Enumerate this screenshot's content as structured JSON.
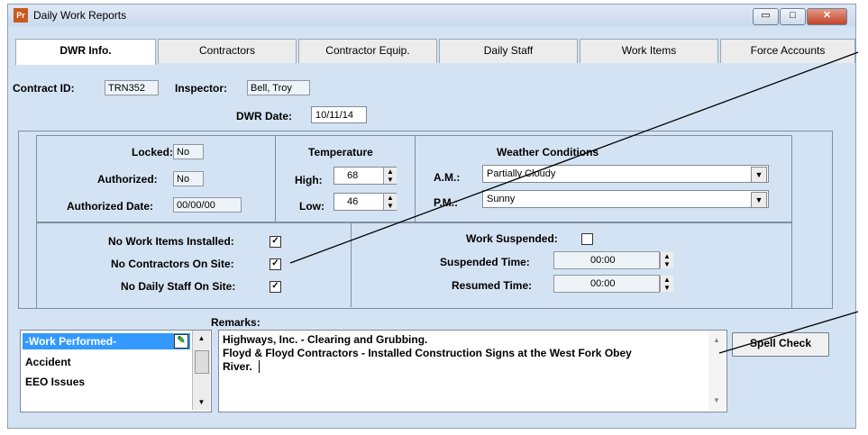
{
  "window": {
    "title": "Daily Work Reports",
    "icon_text": "Pr",
    "btn_min": "▭",
    "btn_max": "□",
    "btn_close": "✕"
  },
  "tabs": [
    "DWR Info.",
    "Contractors",
    "Contractor Equip.",
    "Daily Staff",
    "Work Items",
    "Force Accounts"
  ],
  "header": {
    "contract_id_label": "Contract ID:",
    "contract_id_value": "TRN352",
    "inspector_label": "Inspector:",
    "inspector_value": "Bell, Troy",
    "dwr_date_label": "DWR Date:",
    "dwr_date_value": "10/11/14"
  },
  "status": {
    "locked_label": "Locked:",
    "locked_value": "No",
    "authorized_label": "Authorized:",
    "authorized_value": "No",
    "authorized_date_label": "Authorized Date:",
    "authorized_date_value": "00/00/00"
  },
  "temperature": {
    "heading": "Temperature",
    "high_label": "High:",
    "high_value": "68",
    "low_label": "Low:",
    "low_value": "46"
  },
  "weather": {
    "heading": "Weather Conditions",
    "am_label": "A.M.:",
    "am_value": "Partially Cloudy",
    "pm_label": "P.M.:",
    "pm_value": "Sunny"
  },
  "flags": {
    "no_work_items_label": "No Work Items Installed:",
    "no_work_items_checked": true,
    "no_contractors_label": "No Contractors On Site:",
    "no_contractors_checked": true,
    "no_staff_label": "No Daily Staff On Site:",
    "no_staff_checked": true,
    "check_mark": "✓"
  },
  "suspension": {
    "work_suspended_label": "Work Suspended:",
    "work_suspended_checked": false,
    "suspended_time_label": "Suspended Time:",
    "suspended_time_value": "00:00",
    "resumed_time_label": "Resumed Time:",
    "resumed_time_value": "00:00"
  },
  "remarks": {
    "label": "Remarks:",
    "categories": [
      "-Work Performed-",
      "Accident",
      "EEO Issues"
    ],
    "line1": "Highways, Inc. - Clearing and Grubbing.",
    "line2": "Floyd & Floyd Contractors - Installed Construction Signs at the West Fork Obey",
    "line3": "River.",
    "spell_check_label": "Spell Check"
  },
  "colors": {
    "accent": "#3399ff",
    "panel": "#d4e3f3"
  }
}
